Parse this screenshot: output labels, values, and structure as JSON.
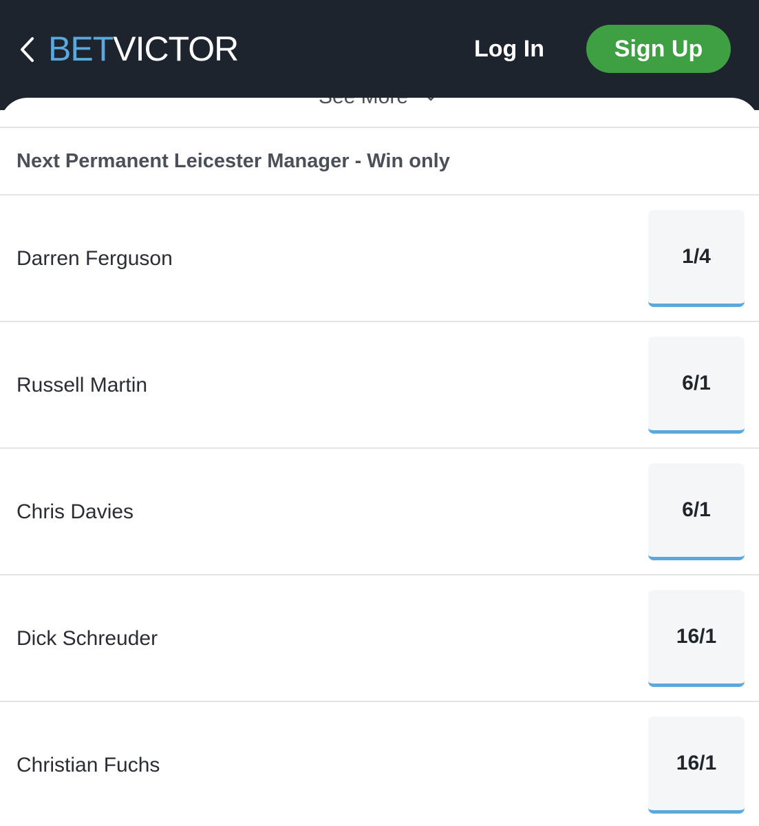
{
  "header": {
    "brand_part1": "BET",
    "brand_part2": "VICTOR",
    "back_icon": "chevron-left-icon",
    "login_label": "Log In",
    "signup_label": "Sign Up"
  },
  "colors": {
    "header_bg": "#1e242d",
    "brand_blue": "#5ba8dc",
    "signup_green": "#3fa043",
    "odds_underline": "#5ba8dc"
  },
  "see_more": {
    "label": "See More",
    "icon": "chevron-down-icon"
  },
  "market": {
    "title": "Next Permanent Leicester Manager - Win only",
    "selections": [
      {
        "name": "Darren Ferguson",
        "odds": "1/4"
      },
      {
        "name": "Russell Martin",
        "odds": "6/1"
      },
      {
        "name": "Chris Davies",
        "odds": "6/1"
      },
      {
        "name": "Dick Schreuder",
        "odds": "16/1"
      },
      {
        "name": "Christian Fuchs",
        "odds": "16/1"
      }
    ]
  }
}
